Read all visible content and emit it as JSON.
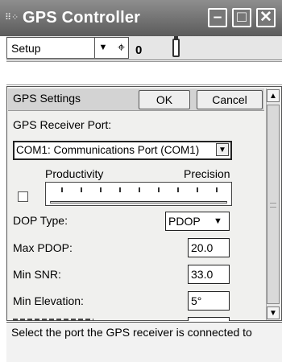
{
  "window": {
    "title": "GPS Controller",
    "icon_name": "gps-app-icon",
    "title_bar_color": "#6f6f6f"
  },
  "menu": {
    "setup_label": "Setup",
    "satellite_count": "0",
    "satellite_icon": "satellite-icon",
    "battery_icon": "battery-icon"
  },
  "panel": {
    "title": "GPS Settings",
    "ok_label": "OK",
    "cancel_label": "Cancel",
    "receiver_port_label": "GPS Receiver Port:",
    "receiver_port_value": "COM1: Communications Port (COM1)",
    "productivity_label": "Productivity",
    "precision_label": "Precision",
    "slider_checked": false,
    "dop_type_label": "DOP Type:",
    "dop_type_value": "PDOP",
    "max_pdop_label": "Max PDOP:",
    "max_pdop_value": "20.0",
    "min_snr_label": "Min SNR:",
    "min_snr_value": "33.0",
    "min_elevation_label": "Min Elevation:",
    "min_elevation_value": "5°"
  },
  "status": {
    "text": "Select the port the GPS receiver is connected to"
  }
}
